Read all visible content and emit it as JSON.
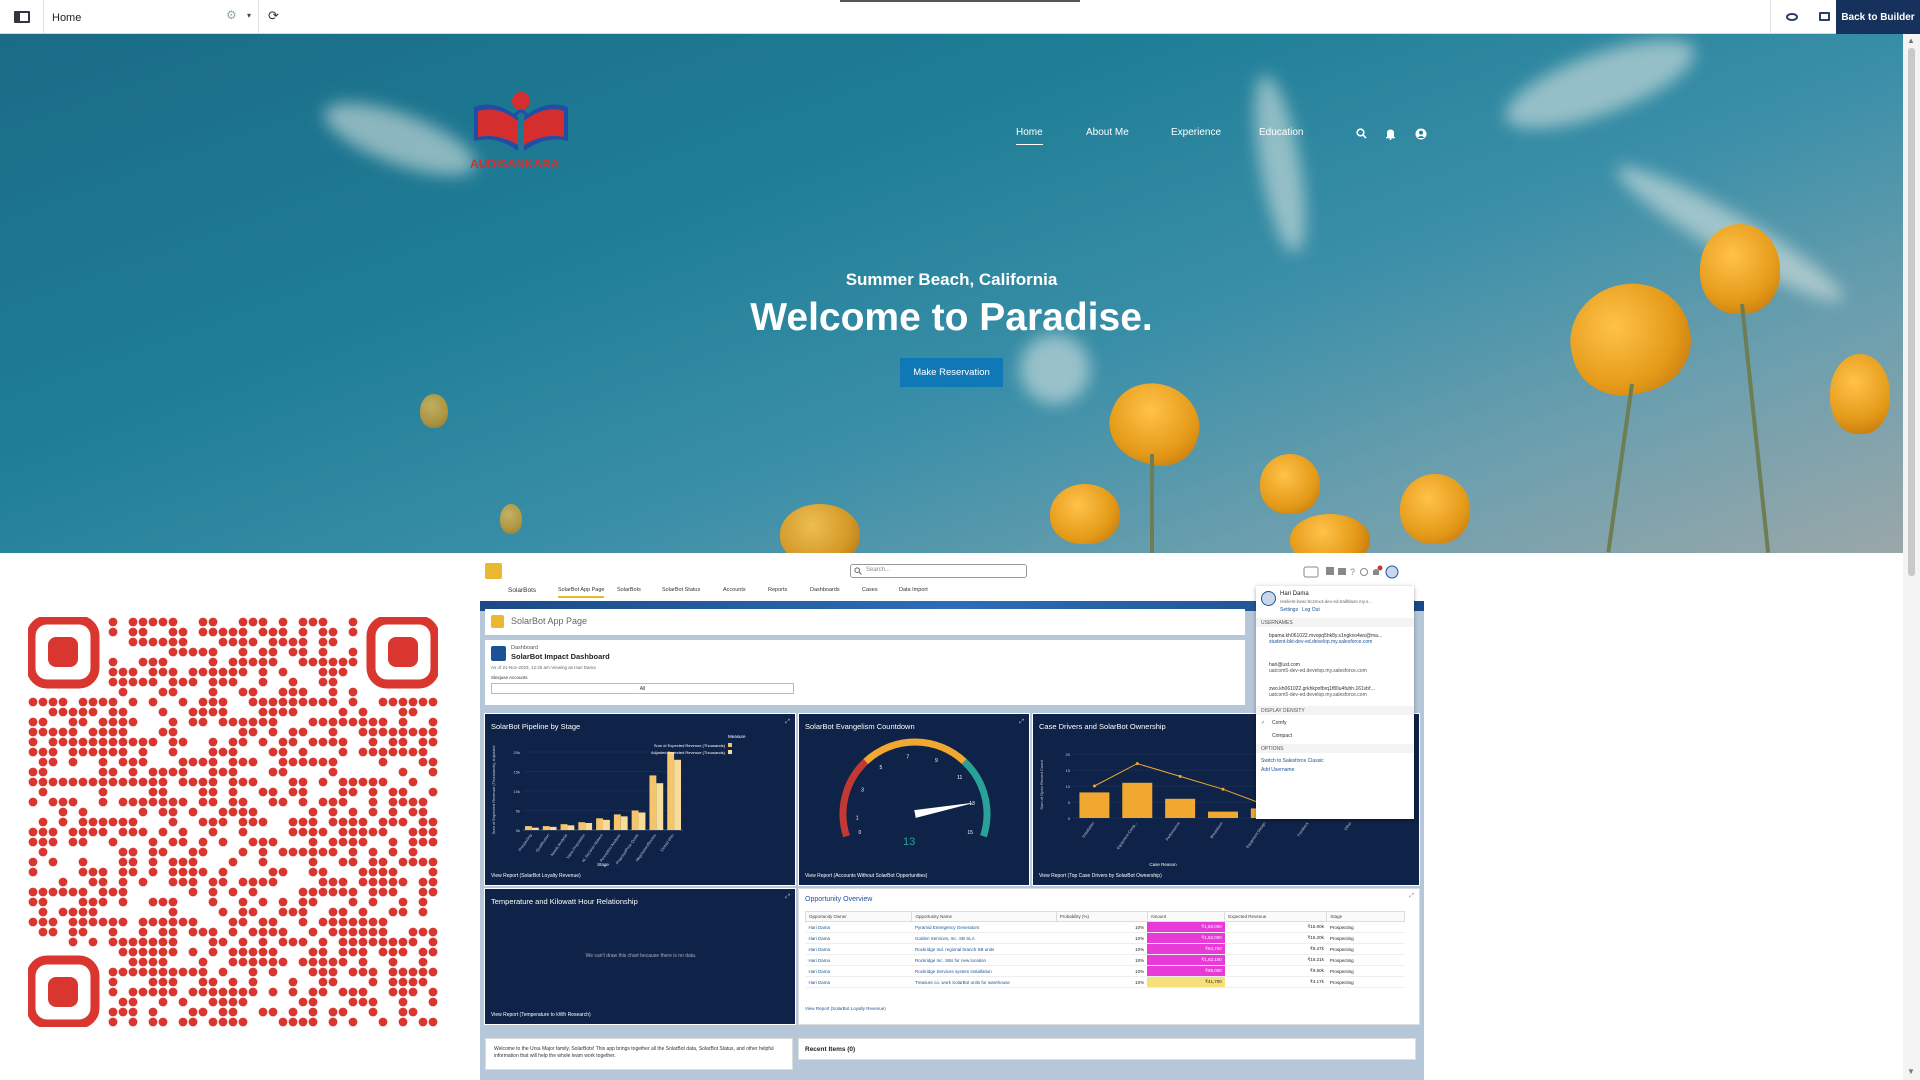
{
  "builder": {
    "page_name": "Home",
    "back_label": "Back to Builder"
  },
  "hero": {
    "logo_text": "AUDISANKARA",
    "nav": [
      "Home",
      "About Me",
      "Experience",
      "Education"
    ],
    "subtitle": "Summer Beach, California",
    "title": "Welcome to Paradise.",
    "cta": "Make Reservation"
  },
  "sf": {
    "app_name": "SolarBots",
    "search_placeholder": "Search...",
    "tabs": [
      "SolarBot App Page",
      "SolarBots",
      "SolarBot Status",
      "Accounts",
      "Reports",
      "Dashboards",
      "Cases",
      "Data Import"
    ],
    "page_title": "SolarBot App Page",
    "dashboard": {
      "kicker": "Dashboard",
      "title": "SolarBot Impact Dashboard",
      "meta": "As of 21-Nov-2023, 12:25 am·Viewing as Hari Dama",
      "filter_label": "Slesjuse Accounts",
      "filter_value": "All"
    },
    "cards": {
      "pipeline": {
        "title": "SolarBot Pipeline by Stage",
        "view": "View Report (SolarBot Loyalty Revenue)",
        "legend_title": "Measure",
        "legend": [
          "Sum of Expected Revenue (Thousands)",
          "Adjusted Expected Revenue (Thousands)"
        ],
        "xlabel": "Stage",
        "ylabel": "Sum of Expected Revenue (Thousands), Adjusted"
      },
      "countdown": {
        "title": "SolarBot Evangelism Countdown",
        "value": "13",
        "view": "View Report (Accounts Without SolarBot Opportunities)"
      },
      "drivers": {
        "title": "Case Drivers and SolarBot Ownership",
        "xlabel": "Case Reason",
        "ylabel": "Sum of Open Record Count",
        "view": "View Report (Top Case Drivers by SolarBot Ownership)"
      },
      "temp": {
        "title": "Temperature and Kilowatt Hour Relationship",
        "empty": "We can't draw this chart because there is no data.",
        "view": "View Report (Temperature to kWh Research)"
      },
      "opps": {
        "title": "Opportunity Overview",
        "headers": [
          "Opportunity Owner",
          "Opportunity Name",
          "Probability (%)",
          "Amount",
          "Expected Revenue",
          "Stage"
        ],
        "rows": [
          [
            "Hari Dama",
            "Pyramid Emergency Generators",
            "10%",
            "₹1,50,000",
            "₹15.00k",
            "Prospecting"
          ],
          [
            "Hari Dama",
            "Golden Services, Inc. SB SLA",
            "10%",
            "₹1,52,000",
            "₹15.20k",
            "Prospecting"
          ],
          [
            "Hari Dama",
            "Rockridge Ind. regional branch SB units",
            "10%",
            "₹84,700",
            "₹8.47k",
            "Prospecting"
          ],
          [
            "Hari Dama",
            "Rockridge Inc. SBs for new location",
            "10%",
            "₹1,62,100",
            "₹16.21k",
            "Prospecting"
          ],
          [
            "Hari Dama",
            "Rockridge Services system installation",
            "10%",
            "₹95,000",
            "₹9.50k",
            "Prospecting"
          ],
          [
            "Hari Dama",
            "Treasure co. work SolarBot units for warehouse",
            "10%",
            "₹41,700",
            "₹4.17k",
            "Prospecting"
          ]
        ],
        "view": "View Report (SolarBot Loyalty Revenue)"
      }
    },
    "welcome": "Welcome to the Ursa Major family, SolarBots! This app brings together all the SolarBot data, SolarBot Status, and other helpful information that will help the whole team work together.",
    "recent": "Recent Items (0)",
    "user_menu": {
      "name": "Hari Dama",
      "username": "resilient-bear-8c2mx4-dev-ed.trailblaze.my.s...",
      "settings": "Settings",
      "logout": "Log Out",
      "usernames_label": "USERNAMES",
      "accounts": [
        {
          "user": "bpama.kh061022.mvopq5hk8y.s1ngkvo4ws@ma...",
          "org": "student-bkt-dev-ed.develop.my.salesforce.com"
        },
        {
          "user": "hari@ust.com",
          "org": "uatcom5-dev-ed.develop.my.salesforce.com"
        },
        {
          "user": "zwo.kh061022.grkhkpnfbrq1f80u4fuhh.161vbf...",
          "org": "uatcom5-dev-ed.develop.my.salesforce.com"
        }
      ],
      "density_label": "DISPLAY DENSITY",
      "density": [
        "Comfy",
        "Compact"
      ],
      "options_label": "OPTIONS",
      "options": [
        "Switch to Salesforce Classic",
        "Add Username"
      ]
    }
  },
  "chart_data": [
    {
      "type": "bar",
      "title": "SolarBot Pipeline by Stage",
      "xlabel": "Stage",
      "ylabel": "Sum of Expected Revenue (Thousands), Adjusted",
      "categories": [
        "Prospecting",
        "Qualification",
        "Needs Analysis",
        "Value Proposition",
        "Id. Decision Makers",
        "Perception Analysis",
        "Proposal/Price Quote",
        "Negotiation/Review",
        "Closed Won"
      ],
      "ylim": [
        0,
        20
      ],
      "series": [
        {
          "name": "Sum of Expected Revenue (Thousands)",
          "values": [
            1,
            1,
            1.5,
            2,
            3,
            4,
            5,
            14,
            20
          ]
        },
        {
          "name": "Adjusted Expected Revenue (Thousands)",
          "values": [
            0.6,
            0.8,
            1.2,
            1.8,
            2.6,
            3.5,
            4.5,
            12,
            18
          ]
        }
      ]
    },
    {
      "type": "gauge",
      "title": "SolarBot Evangelism Countdown",
      "value": 13,
      "range": [
        0,
        15
      ]
    },
    {
      "type": "bar",
      "title": "Case Drivers and SolarBot Ownership",
      "xlabel": "Case Reason",
      "ylabel": "Sum of Open Record Count",
      "categories": [
        "Installation",
        "Equipment Comp...",
        "Performance",
        "Breakdown",
        "Equipment Design",
        "Feedback",
        "Other"
      ],
      "ylim": [
        0,
        20
      ],
      "series": [
        {
          "values": [
            8,
            11,
            6,
            2,
            3,
            5,
            3
          ]
        },
        {
          "values": [
            10,
            17,
            13,
            9,
            4,
            6,
            4
          ]
        }
      ]
    }
  ],
  "colors": {
    "hero_accent": "#0f79b8",
    "builder_dark": "#16325c",
    "qr_red": "#d93630",
    "sf_card": "#0f2247"
  }
}
